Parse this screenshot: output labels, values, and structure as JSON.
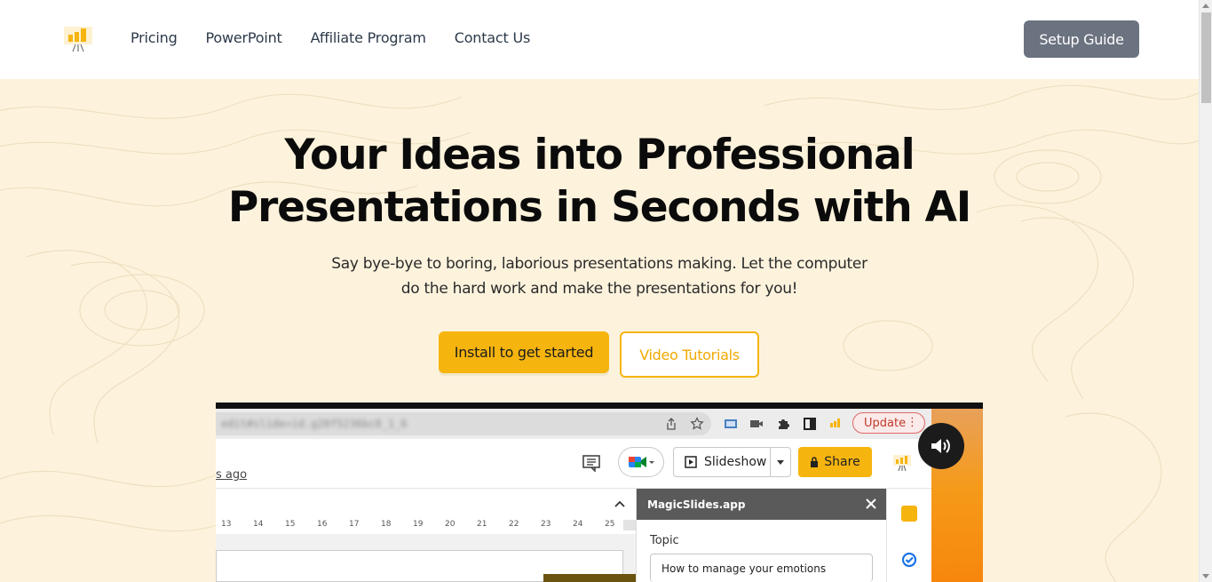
{
  "nav": {
    "links": [
      "Pricing",
      "PowerPoint",
      "Affiliate Program",
      "Contact Us"
    ],
    "setup_label": "Setup Guide"
  },
  "hero": {
    "headline_line1": "Your Ideas into Professional",
    "headline_line2": "Presentations in Seconds with AI",
    "sub_line1": "Say bye-bye to boring, laborious presentations making. Let the computer",
    "sub_line2": "do the hard work and make the presentations for you!",
    "install_label": "Install to get started",
    "video_label": "Video Tutorials"
  },
  "screenshot": {
    "url_text": "edit#slide=id.g20f5236bc8_1_6",
    "update_label": "Update",
    "ago_text": "s ago",
    "slideshow_label": "Slideshow",
    "share_label": "Share",
    "ruler_ticks": [
      "13",
      "14",
      "15",
      "16",
      "17",
      "18",
      "19",
      "20",
      "21",
      "22",
      "23",
      "24",
      "25"
    ],
    "panel_title": "MagicSlides.app",
    "topic_label": "Topic",
    "topic_value": "How to manage your emotions"
  },
  "colors": {
    "accent": "#f6b40e",
    "setup_button": "#6b7280",
    "hero_bg": "#fdf3dd"
  },
  "icons": [
    "logo-icon",
    "share-page-icon",
    "star-icon",
    "photo-icon",
    "video-icon",
    "puzzle-icon",
    "sidepanel-icon",
    "comment-icon",
    "meet-icon",
    "play-icon",
    "lock-icon",
    "close-icon",
    "chevron-up-icon",
    "keep-icon",
    "tasks-icon",
    "volume-icon"
  ]
}
